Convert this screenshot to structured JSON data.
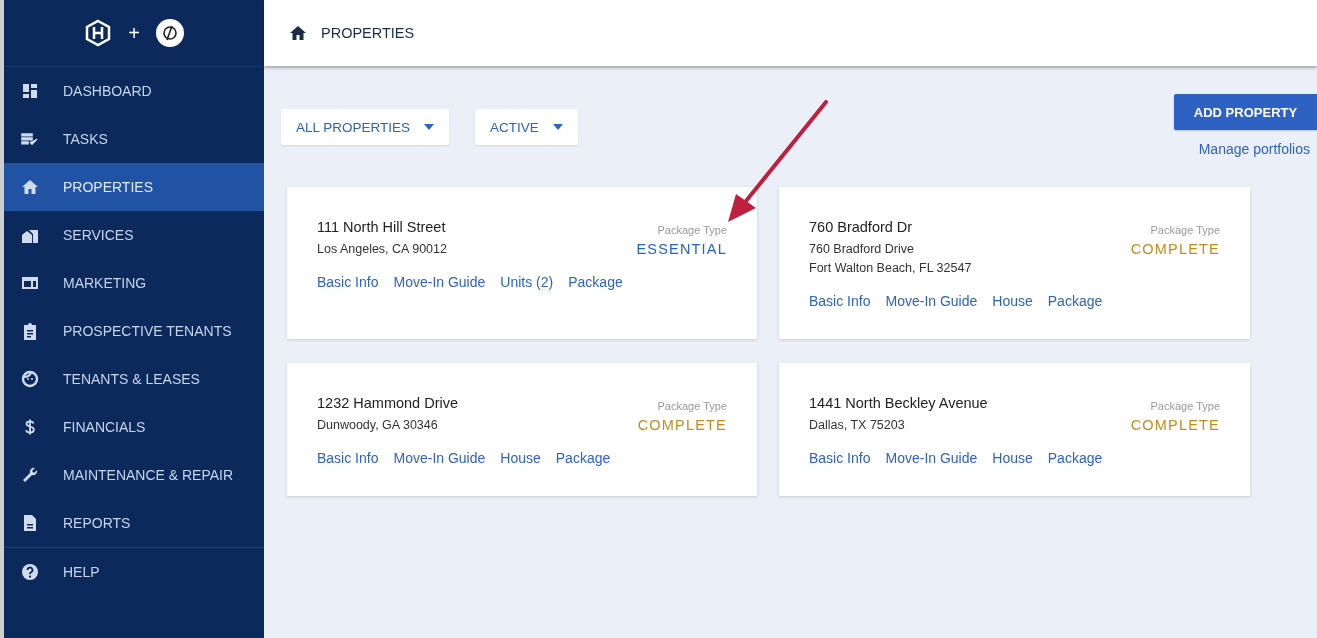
{
  "sidebar": {
    "logo_separator": "+",
    "items": [
      {
        "label": "DASHBOARD",
        "selected": false
      },
      {
        "label": "TASKS",
        "selected": false
      },
      {
        "label": "PROPERTIES",
        "selected": true
      },
      {
        "label": "SERVICES",
        "selected": false
      },
      {
        "label": "MARKETING",
        "selected": false
      },
      {
        "label": "PROSPECTIVE TENANTS",
        "selected": false
      },
      {
        "label": "TENANTS & LEASES",
        "selected": false
      },
      {
        "label": "FINANCIALS",
        "selected": false
      },
      {
        "label": "MAINTENANCE & REPAIR",
        "selected": false
      },
      {
        "label": "REPORTS",
        "selected": false
      }
    ],
    "footer_items": [
      {
        "label": "HELP",
        "selected": false
      }
    ]
  },
  "header": {
    "title": "PROPERTIES"
  },
  "filters": [
    {
      "label": "ALL PROPERTIES"
    },
    {
      "label": "ACTIVE"
    }
  ],
  "add_button": "ADD PROPERTY",
  "manage_link": "Manage portfolios",
  "cards": [
    {
      "title": "111 North Hill Street",
      "address_lines": [
        "Los Angeles, CA 90012"
      ],
      "package_label": "Package Type",
      "package": "ESSENTIAL",
      "color": "#2563c0",
      "links": [
        "Basic Info",
        "Move-In Guide",
        "Units (2)",
        "Package"
      ]
    },
    {
      "title": "760 Bradford Dr",
      "address_lines": [
        "760 Bradford Drive",
        "Fort Walton Beach, FL 32547"
      ],
      "package_label": "Package Type",
      "package": "COMPLETE",
      "color": "#c68a1c",
      "links": [
        "Basic Info",
        "Move-In Guide",
        "House",
        "Package"
      ]
    },
    {
      "title": "1232 Hammond Drive",
      "address_lines": [
        "Dunwoody, GA 30346"
      ],
      "package_label": "Package Type",
      "package": "COMPLETE",
      "color": "#c68a1c",
      "links": [
        "Basic Info",
        "Move-In Guide",
        "House",
        "Package"
      ]
    },
    {
      "title": "1441 North Beckley Avenue",
      "address_lines": [
        "Dallas, TX 75203"
      ],
      "package_label": "Package Type",
      "package": "COMPLETE",
      "color": "#c68a1c",
      "links": [
        "Basic Info",
        "Move-In Guide",
        "House",
        "Package"
      ]
    }
  ]
}
